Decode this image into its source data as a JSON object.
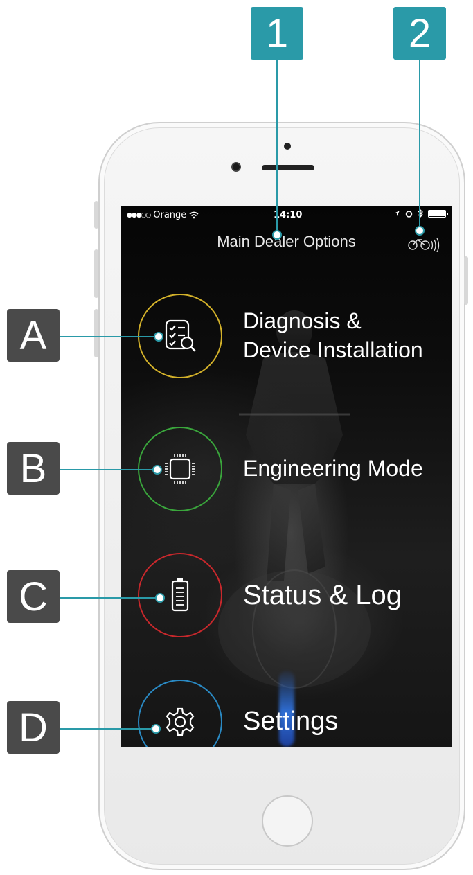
{
  "callouts": {
    "numbers": [
      "1",
      "2"
    ],
    "letters": [
      "A",
      "B",
      "C",
      "D"
    ]
  },
  "status_bar": {
    "signal_dots": "●●●○○",
    "carrier": "Orange",
    "time": "14:10",
    "battery_level": 1.0
  },
  "nav": {
    "title": "Main Dealer Options",
    "connection_icon": "bike-connection-icon"
  },
  "menu": [
    {
      "label_line1": "Diagnosis &",
      "label_line2": "Device Installation",
      "icon": "checklist-search-icon",
      "ring_color": "#d4b22a"
    },
    {
      "label": "Engineering Mode",
      "icon": "chip-icon",
      "ring_color": "#3aa63c"
    },
    {
      "label": "Status & Log",
      "icon": "battery-icon",
      "ring_color": "#c9282c"
    },
    {
      "label": "Settings",
      "icon": "gear-icon",
      "ring_color": "#2a8ac4"
    }
  ],
  "colors": {
    "callout_number_bg": "#2a9aa8",
    "callout_letter_bg": "#4a4a4a"
  }
}
